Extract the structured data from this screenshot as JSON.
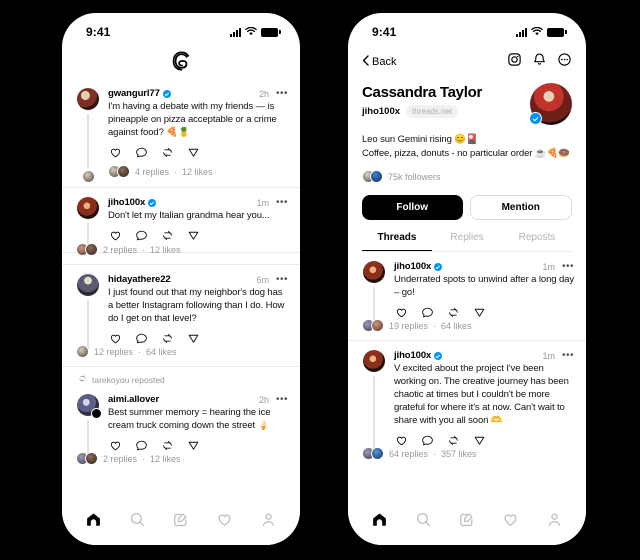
{
  "status_bar": {
    "time": "9:41"
  },
  "left_phone": {
    "logo": "threads-logo",
    "posts": [
      {
        "username": "gwangurl77",
        "verified": true,
        "timestamp": "2h",
        "text": "I'm having a debate with my friends — is pineapple on pizza acceptable or a crime against food? 🍕🍍",
        "replies": "4 replies",
        "likes": "12 likes",
        "separator": "·"
      },
      {
        "username": "jiho100x",
        "verified": true,
        "timestamp": "1m",
        "text": "Don't let my Italian grandma hear you...",
        "replies": "2 replies",
        "likes": "12 likes",
        "separator": "·"
      },
      {
        "username": "hidayathere22",
        "verified": false,
        "timestamp": "6m",
        "text": "I just found out that my neighbor's dog has a better Instagram following than I do. How do I get on that level?",
        "replies": "12 replies",
        "likes": "64 likes",
        "separator": "·"
      },
      {
        "repost_label": "tarekoyou reposted",
        "username": "aimi.allover",
        "verified": false,
        "timestamp": "2h",
        "text": "Best summer memory = hearing the ice cream truck coming down the street 🍦",
        "replies": "2 replies",
        "likes": "12 likes",
        "separator": "·"
      }
    ],
    "tabbar": [
      {
        "name": "home-tab",
        "label": "Home",
        "active": true
      },
      {
        "name": "search-tab",
        "label": "Search",
        "active": false
      },
      {
        "name": "compose-tab",
        "label": "Compose",
        "active": false
      },
      {
        "name": "activity-tab",
        "label": "Activity",
        "active": false
      },
      {
        "name": "profile-tab",
        "label": "Profile",
        "active": false
      }
    ]
  },
  "right_phone": {
    "nav": {
      "back_label": "Back",
      "icons": [
        "instagram-icon",
        "bell-icon",
        "more-circle-icon"
      ]
    },
    "profile": {
      "display_name": "Cassandra Taylor",
      "handle": "jiho100x",
      "domain_pill": "threads.net",
      "verified": true,
      "bio_line_1": "Leo sun Gemini rising 😊🎴",
      "bio_line_2": "Coffee, pizza, donuts - no particular order ☕🍕🍩",
      "followers": "75k followers",
      "follow_button": "Follow",
      "mention_button": "Mention"
    },
    "tabs": [
      {
        "label": "Threads",
        "active": true
      },
      {
        "label": "Replies",
        "active": false
      },
      {
        "label": "Reposts",
        "active": false
      }
    ],
    "posts": [
      {
        "username": "jiho100x",
        "verified": true,
        "timestamp": "1m",
        "text": "Underrated spots to unwind after a long day – go!",
        "replies": "19 replies",
        "likes": "64 likes",
        "separator": "·"
      },
      {
        "username": "jiho100x",
        "verified": true,
        "timestamp": "1m",
        "text": "V excited about the project I've been working on. The creative journey has been chaotic at times but I couldn't be more grateful for where it's at now. Can't wait to share with you all soon 🫶",
        "replies": "64 replies",
        "likes": "357 likes",
        "separator": "·"
      }
    ],
    "tabbar": [
      {
        "name": "home-tab",
        "label": "Home",
        "active": true
      },
      {
        "name": "search-tab",
        "label": "Search",
        "active": false
      },
      {
        "name": "compose-tab",
        "label": "Compose",
        "active": false
      },
      {
        "name": "activity-tab",
        "label": "Activity",
        "active": false
      },
      {
        "name": "profile-tab",
        "label": "Profile",
        "active": false
      }
    ]
  },
  "colors": {
    "background": "#000000",
    "surface": "#ffffff",
    "text": "#111111",
    "muted": "#999999",
    "verified_blue": "#0095f6",
    "divider": "#eaeaea"
  }
}
